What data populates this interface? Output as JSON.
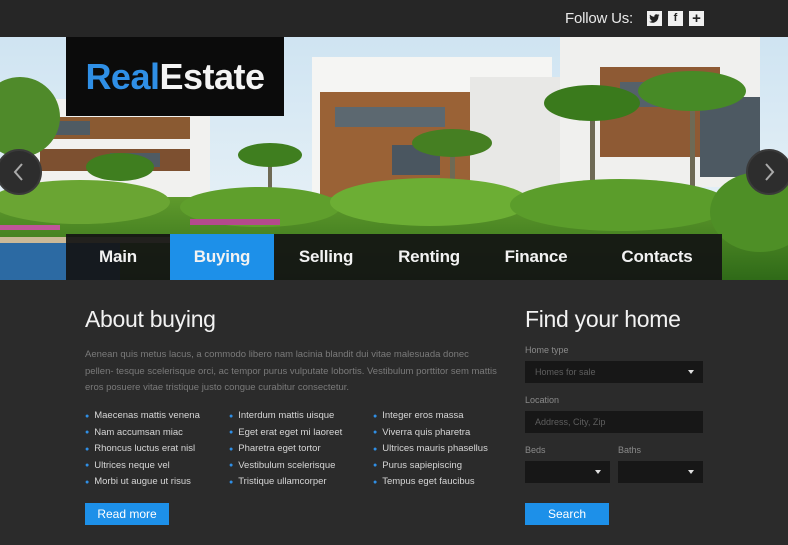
{
  "brand": {
    "part1": "Real",
    "part2": "Estate"
  },
  "header": {
    "follow_label": "Follow Us:",
    "social": [
      {
        "name": "twitter-icon",
        "glyph": "t"
      },
      {
        "name": "facebook-icon",
        "glyph": "f"
      },
      {
        "name": "plus-icon",
        "glyph": "+"
      }
    ]
  },
  "nav": {
    "items": [
      "Main",
      "Buying",
      "Selling",
      "Renting",
      "Finance",
      "Contacts"
    ],
    "active": "Buying"
  },
  "about": {
    "title": "About buying",
    "paragraph": "Aenean quis metus lacus, a commodo libero nam lacinia blandit dui vitae malesuada donec pellen- tesque scelerisque orci, ac tempor purus vulputate lobortis. Vestibulum porttitor sem mattis eros posuere vitae tristique justo congue curabitur consectetur.",
    "list_col1": [
      "Maecenas mattis venena",
      "Nam accumsan miac",
      "Rhoncus luctus erat nisl",
      "Ultrices neque vel",
      "Morbi ut augue ut risus"
    ],
    "list_col2": [
      "Interdum mattis uisque",
      "Eget erat eget mi laoreet",
      "Pharetra eget tortor",
      "Vestibulum scelerisque",
      "Tristique ullamcorper"
    ],
    "list_col3": [
      "Integer eros massa",
      "Viverra quis pharetra",
      "Ultrices mauris phasellus",
      "Purus sapiepiscing",
      "Tempus eget faucibus"
    ],
    "read_more": "Read more"
  },
  "find": {
    "title": "Find your home",
    "home_type_label": "Home type",
    "home_type_value": "Homes for sale",
    "location_label": "Location",
    "location_placeholder": "Address, City, Zip",
    "beds_label": "Beds",
    "baths_label": "Baths",
    "search_label": "Search"
  },
  "colors": {
    "accent": "#1d90e9",
    "background": "#2b2b2b"
  }
}
